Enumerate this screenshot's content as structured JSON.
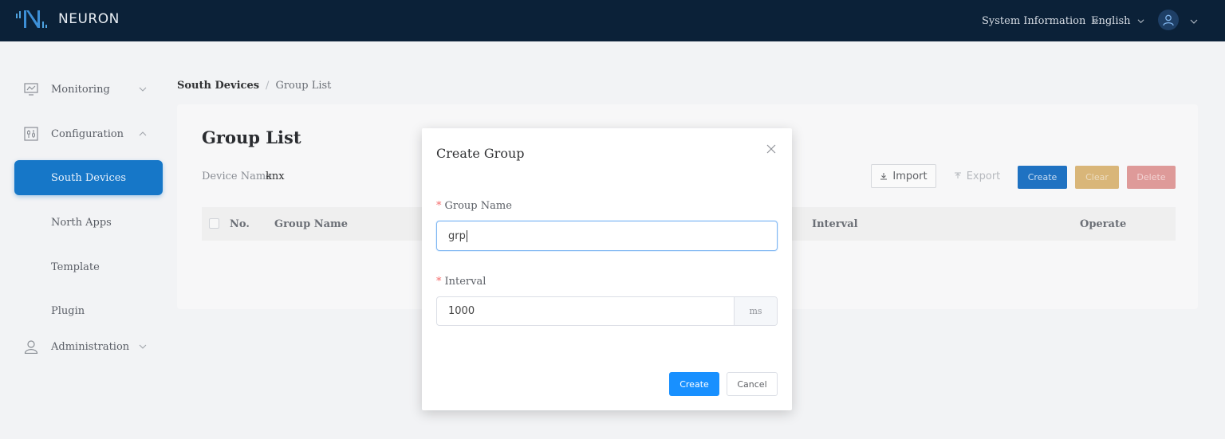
{
  "header": {
    "brand": "NEURON",
    "system_info": "System Information",
    "language": "English"
  },
  "sidebar": {
    "items": [
      {
        "label": "Monitoring",
        "icon": "monitor-icon"
      },
      {
        "label": "Configuration",
        "icon": "config-icon"
      },
      {
        "label": "South Devices"
      },
      {
        "label": "North Apps"
      },
      {
        "label": "Template"
      },
      {
        "label": "Plugin"
      },
      {
        "label": "Administration",
        "icon": "user-icon"
      }
    ]
  },
  "breadcrumb": {
    "parent": "South Devices",
    "separator": "/",
    "current": "Group List"
  },
  "main": {
    "title": "Group List",
    "device_label": "Device Name",
    "device_value": "knx",
    "buttons": {
      "import": "Import",
      "export": "Export",
      "create": "Create",
      "clear": "Clear",
      "delete": "Delete"
    },
    "table_headers": [
      "No.",
      "Group Name",
      "Interval",
      "Operate"
    ]
  },
  "modal": {
    "title": "Create Group",
    "group_name_label": "Group Name",
    "group_name_value": "grp",
    "interval_label": "Interval",
    "interval_value": "1000",
    "interval_unit": "ms",
    "create_label": "Create",
    "cancel_label": "Cancel"
  },
  "colors": {
    "header_bg": "#0b2138",
    "accent": "#1890ff",
    "active_nav": "#1677c8"
  }
}
